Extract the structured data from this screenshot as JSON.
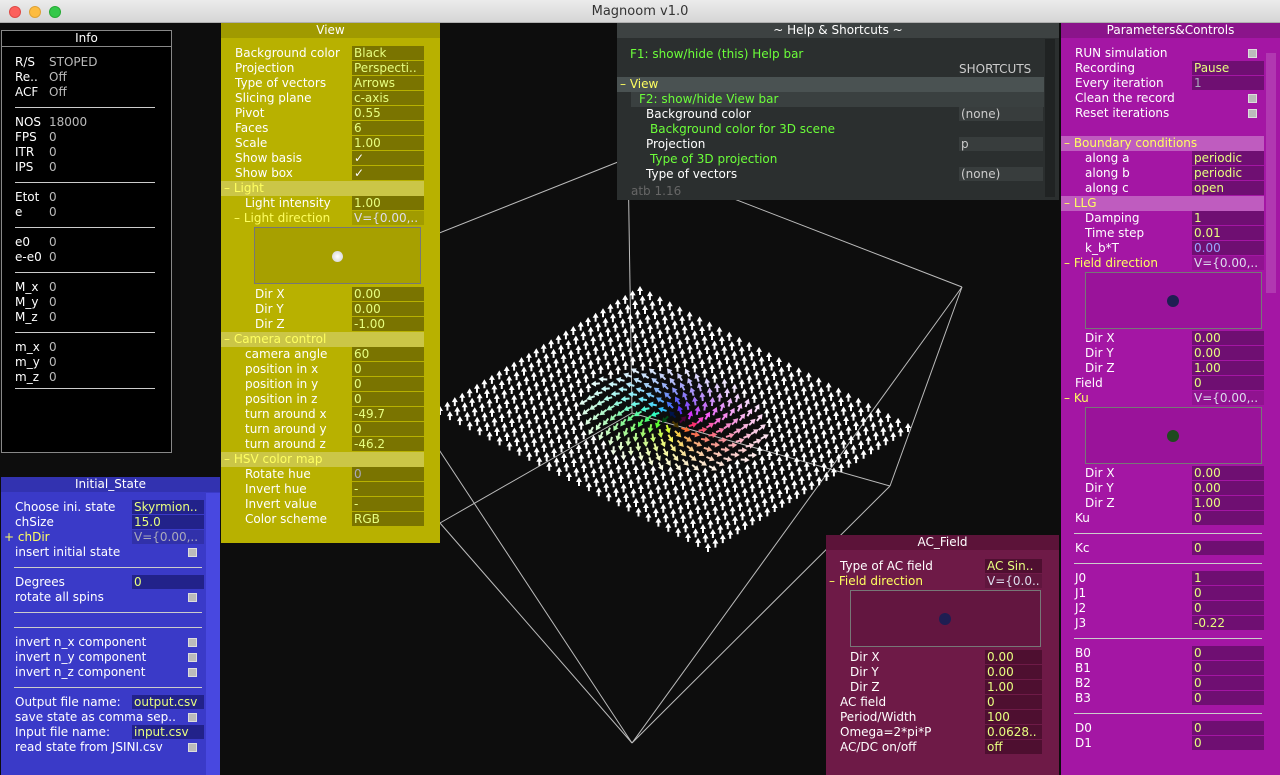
{
  "window": {
    "title": "Magnoom v1.0"
  },
  "info": {
    "title": "Info",
    "rows": [
      {
        "k": "R/S",
        "v": "STOPED"
      },
      {
        "k": "Re..",
        "v": "Off"
      },
      {
        "k": "ACF",
        "v": "Off"
      },
      {
        "k": "NOS",
        "v": "18000"
      },
      {
        "k": "FPS",
        "v": "0"
      },
      {
        "k": "ITR",
        "v": "0"
      },
      {
        "k": "IPS",
        "v": "0"
      },
      {
        "k": "Etot",
        "v": "0"
      },
      {
        "k": "e",
        "v": "0"
      },
      {
        "k": "e0",
        "v": "0"
      },
      {
        "k": "e-e0",
        "v": "0"
      },
      {
        "k": "M_x",
        "v": "0"
      },
      {
        "k": "M_y",
        "v": "0"
      },
      {
        "k": "M_z",
        "v": "0"
      },
      {
        "k": "m_x",
        "v": "0"
      },
      {
        "k": "m_y",
        "v": "0"
      },
      {
        "k": "m_z",
        "v": "0"
      }
    ]
  },
  "view": {
    "title": "View",
    "bg_label": "Background color",
    "bg_val": "Black",
    "proj_label": "Projection",
    "proj_val": "Perspecti..",
    "vec_label": "Type of vectors",
    "vec_val": "Arrows",
    "slice_label": "Slicing plane",
    "slice_val": "c-axis",
    "pivot_label": "Pivot",
    "pivot_val": "0.55",
    "faces_label": "Faces",
    "faces_val": "6",
    "scale_label": "Scale",
    "scale_val": "1.00",
    "basis_label": "Show basis",
    "box_label": "Show box",
    "check": "✓",
    "light_group": "Light",
    "intensity_label": "Light intensity",
    "intensity_val": "1.00",
    "ldir_label": "Light direction",
    "ldir_val": "V={0.00,..",
    "dx_label": "Dir X",
    "dx_val": "0.00",
    "dy_label": "Dir Y",
    "dy_val": "0.00",
    "dz_label": "Dir Z",
    "dz_val": "-1.00",
    "cam_group": "Camera control",
    "angle_label": "camera angle",
    "angle_val": "60",
    "px_label": "position in x",
    "px_val": "0",
    "py_label": "position in y",
    "py_val": "0",
    "pz_label": "position in z",
    "pz_val": "0",
    "tx_label": "turn around x",
    "tx_val": "-49.7",
    "ty_label": "turn around y",
    "ty_val": "0",
    "tz_label": "turn around z",
    "tz_val": "-46.2",
    "hsv_group": "HSV color map",
    "rot_label": "Rotate hue",
    "rot_val": "0",
    "invh_label": "Invert hue",
    "invh_val": "-",
    "invv_label": "Invert value",
    "invv_val": "-",
    "scheme_label": "Color scheme",
    "scheme_val": "RGB"
  },
  "help": {
    "title": "~ Help & Shortcuts ~",
    "f1": "F1: show/hide (this) Help bar",
    "shortcuts": "SHORTCUTS",
    "view": "View",
    "f2": "F2: show/hide View bar",
    "bg": "Background color",
    "bg_key": "(none)",
    "bg_desc": "Background color for 3D scene",
    "proj": "Projection",
    "proj_key": "p",
    "proj_desc": "Type of 3D projection",
    "vec": "Type of vectors",
    "vec_key": "(none)",
    "version": "atb  1.16"
  },
  "params": {
    "title": "Parameters&Controls",
    "run": "RUN simulation",
    "rec": "Recording",
    "rec_val": "Pause",
    "every": "Every iteration",
    "every_val": "1",
    "clean": "Clean the record",
    "reset": "Reset iterations",
    "bc_group": "Boundary conditions",
    "a": "along a",
    "a_val": "periodic",
    "b": "along b",
    "b_val": "periodic",
    "c": "along c",
    "c_val": "open",
    "llg_group": "LLG",
    "damp": "Damping",
    "damp_val": "1",
    "ts": "Time step",
    "ts_val": "0.01",
    "kbt": "k_b*T",
    "kbt_val": "0.00",
    "fdir": "Field direction",
    "fdir_val": "V={0.00,..",
    "dx": "Dir X",
    "dx_val": "0.00",
    "dy": "Dir Y",
    "dy_val": "0.00",
    "dz": "Dir Z",
    "dz_val": "1.00",
    "field": "Field",
    "field_val": "0",
    "ku_grp": "Ku",
    "ku_grp_val": "V={0.00,..",
    "kdx": "Dir X",
    "kdx_val": "0.00",
    "kdy": "Dir Y",
    "kdy_val": "0.00",
    "kdz": "Dir Z",
    "kdz_val": "1.00",
    "ku": "Ku",
    "ku_val": "0",
    "kc": "Kc",
    "kc_val": "0",
    "j0": "J0",
    "j0_val": "1",
    "j1": "J1",
    "j1_val": "0",
    "j2": "J2",
    "j2_val": "0",
    "j3": "J3",
    "j3_val": "-0.22",
    "b0": "B0",
    "b0_val": "0",
    "b1": "B1",
    "b1_val": "0",
    "b2": "B2",
    "b2_val": "0",
    "b3": "B3",
    "b3_val": "0",
    "d0": "D0",
    "d0_val": "0",
    "d1": "D1",
    "d1_val": "0"
  },
  "init": {
    "title": "Initial_State",
    "choose": "Choose ini. state",
    "choose_val": "Skyrmion..",
    "chsize": "chSize",
    "chsize_val": "15.0",
    "chdir": "chDir",
    "chdir_val": "V={0.00,..",
    "insert": "insert initial state",
    "deg": "Degrees",
    "deg_val": "0",
    "rotate": "rotate all spins",
    "invx": "invert n_x component",
    "invy": "invert n_y component",
    "invz": "invert n_z component",
    "out": "Output file name:",
    "out_val": "output.csv",
    "save": "save state as comma sep..",
    "inp": "Input file name:",
    "inp_val": "input.csv",
    "read": "read state from JSINI.csv"
  },
  "ac": {
    "title": "AC_Field",
    "type": "Type of AC field",
    "type_val": "AC Sin..",
    "fdir": "Field direction",
    "fdir_val": "V={0.0..",
    "dx": "Dir X",
    "dx_val": "0.00",
    "dy": "Dir Y",
    "dy_val": "0.00",
    "dz": "Dir Z",
    "dz_val": "1.00",
    "acf": "AC field",
    "acf_val": "0",
    "per": "Period/Width",
    "per_val": "100",
    "om": "Omega=2*pi*P",
    "om_val": "0.0628..",
    "onoff": "AC/DC on/off",
    "onoff_val": "off"
  },
  "colors": {
    "view": "#b8b100",
    "params": "#a416a4",
    "init": "#3a3ac8",
    "ac": "#6e1a47",
    "help": "#2b2f2f",
    "green_text": "#6cff3a",
    "yellow_text": "#ffff60"
  }
}
